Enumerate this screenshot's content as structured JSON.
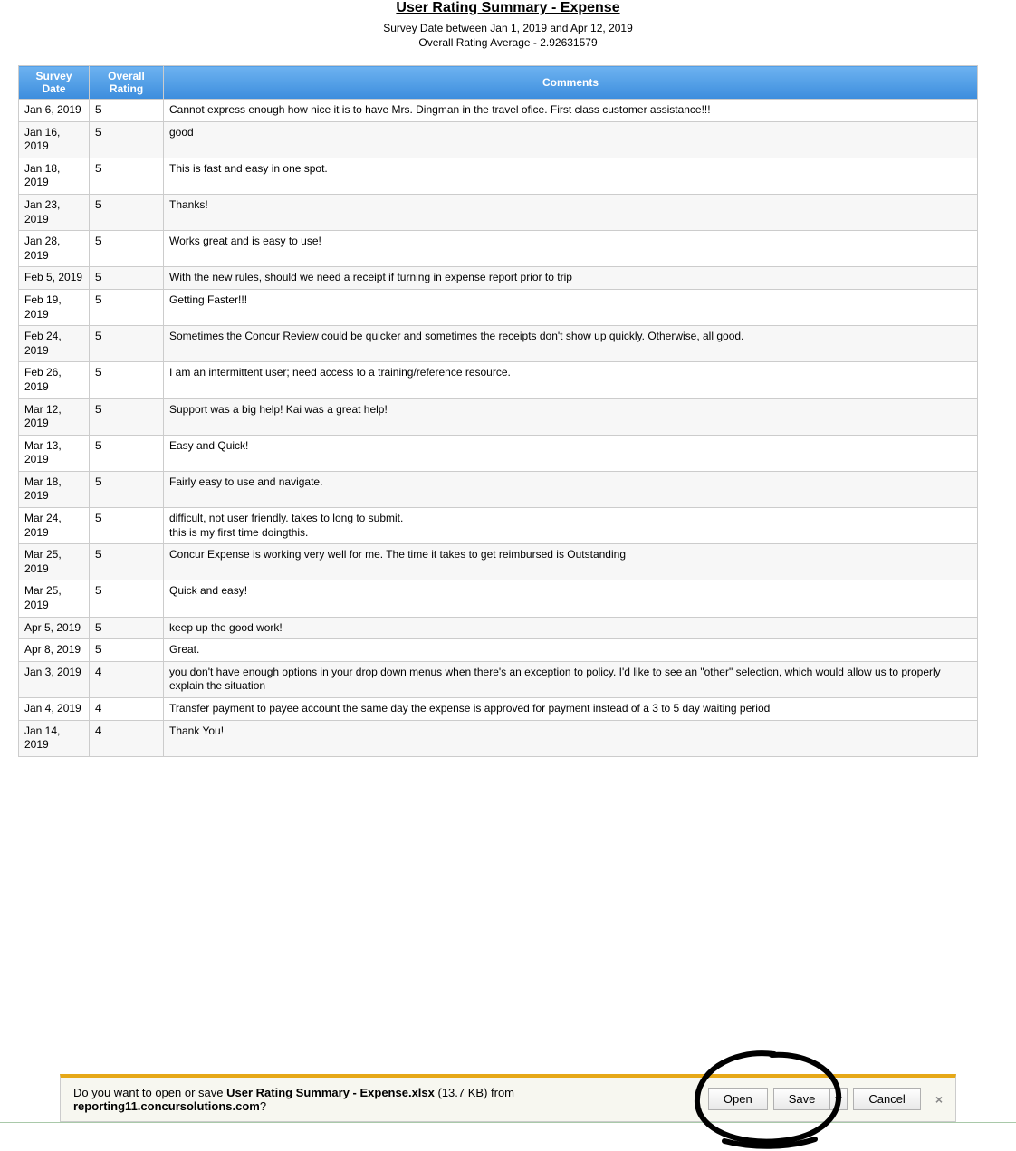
{
  "header": {
    "title": "User Rating Summary - Expense",
    "subtitle": "Survey Date between Jan 1, 2019  and Apr 12, 2019",
    "avg": "Overall Rating Average - 2.92631579"
  },
  "columns": {
    "date": "Survey Date",
    "rating": "Overall Rating",
    "comments": "Comments"
  },
  "rows": [
    {
      "date": "Jan 6, 2019",
      "rating": "5",
      "comment": "Cannot express enough how nice it is to have Mrs. Dingman in the travel ofice. First class customer assistance!!!"
    },
    {
      "date": "Jan 16, 2019",
      "rating": "5",
      "comment": "good"
    },
    {
      "date": "Jan 18, 2019",
      "rating": "5",
      "comment": "This is fast and easy in one spot."
    },
    {
      "date": "Jan 23, 2019",
      "rating": "5",
      "comment": "Thanks!"
    },
    {
      "date": "Jan 28, 2019",
      "rating": "5",
      "comment": "Works great and is easy to use!"
    },
    {
      "date": "Feb 5, 2019",
      "rating": "5",
      "comment": "With the new rules, should we need a receipt if turning in expense report prior to trip"
    },
    {
      "date": "Feb 19, 2019",
      "rating": "5",
      "comment": "Getting Faster!!!"
    },
    {
      "date": "Feb 24, 2019",
      "rating": "5",
      "comment": "Sometimes the Concur Review could be quicker and sometimes the receipts don't show up quickly.  Otherwise, all good."
    },
    {
      "date": "Feb 26, 2019",
      "rating": "5",
      "comment": "I am an intermittent user; need access to a training/reference resource."
    },
    {
      "date": "Mar 12, 2019",
      "rating": "5",
      "comment": "Support was a big help!  Kai was a great help!"
    },
    {
      "date": "Mar 13, 2019",
      "rating": "5",
      "comment": "Easy and Quick!"
    },
    {
      "date": "Mar 18, 2019",
      "rating": "5",
      "comment": "Fairly easy to use and navigate."
    },
    {
      "date": "Mar 24, 2019",
      "rating": "5",
      "comment": "difficult, not user friendly. takes to long to submit.\nthis is my first time doingthis."
    },
    {
      "date": "Mar 25, 2019",
      "rating": "5",
      "comment": "Concur Expense is working very well for me.   The time it takes to get reimbursed is Outstanding"
    },
    {
      "date": "Mar 25, 2019",
      "rating": "5",
      "comment": "Quick and easy!"
    },
    {
      "date": "Apr 5, 2019",
      "rating": "5",
      "comment": "keep up the good work!"
    },
    {
      "date": "Apr 8, 2019",
      "rating": "5",
      "comment": "Great."
    },
    {
      "date": "Jan 3, 2019",
      "rating": "4",
      "comment": "you don't have enough options in your drop down menus when there's an exception to policy.  I'd like to see an \"other\" selection, which would allow us to properly explain the situation"
    },
    {
      "date": "Jan 4, 2019",
      "rating": "4",
      "comment": "Transfer payment to payee account the same day the expense is approved for payment instead of a 3 to 5 day waiting period"
    },
    {
      "date": "Jan 14, 2019",
      "rating": "4",
      "comment": "Thank You!"
    }
  ],
  "download": {
    "prefix": "Do you want to open or save ",
    "filename": "User Rating Summary - Expense.xlsx",
    "size": " (13.7 KB) from ",
    "host": "reporting11.concursolutions.com",
    "suffix": "?",
    "open": "Open",
    "save": "Save",
    "cancel": "Cancel"
  }
}
